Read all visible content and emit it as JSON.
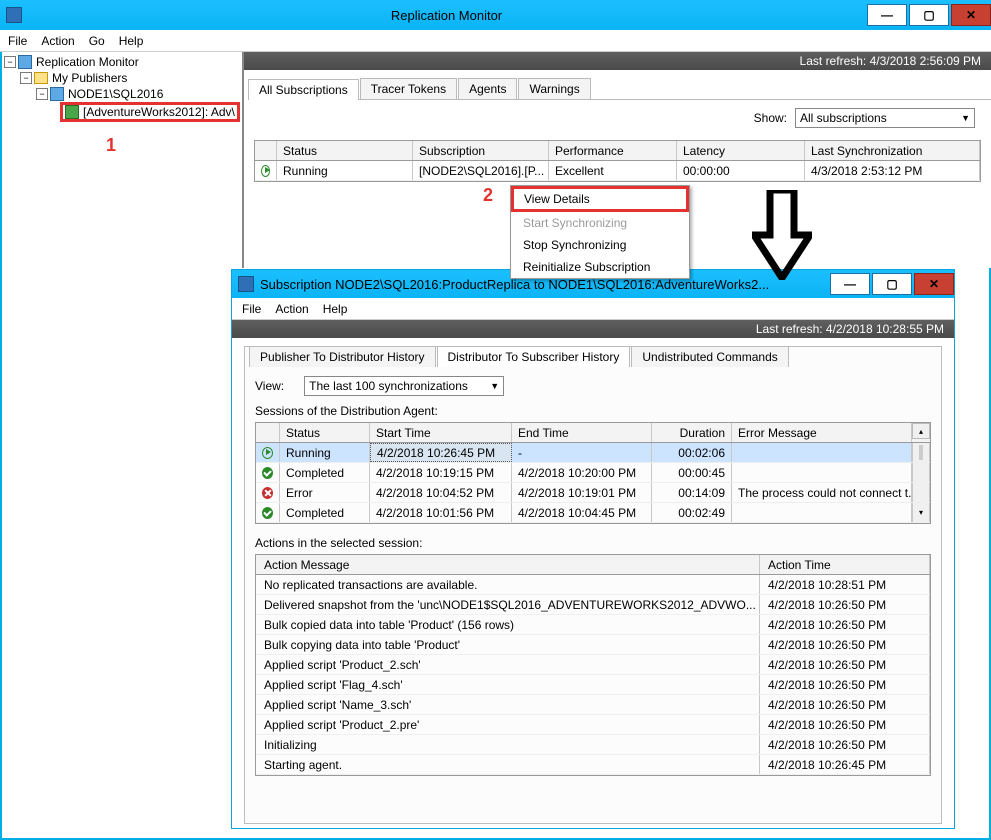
{
  "win1": {
    "title": "Replication Monitor",
    "menu": [
      "File",
      "Action",
      "Go",
      "Help"
    ],
    "last_refresh": "Last refresh: 4/3/2018 2:56:09 PM",
    "tree": {
      "root": "Replication Monitor",
      "publishers": "My Publishers",
      "node": "NODE1\\SQL2016",
      "pub": "[AdventureWorks2012]: Adv\\"
    },
    "tabs": [
      "All Subscriptions",
      "Tracer Tokens",
      "Agents",
      "Warnings"
    ],
    "show_label": "Show:",
    "show_value": "All subscriptions",
    "grid_headers": {
      "status": "Status",
      "subscription": "Subscription",
      "performance": "Performance",
      "latency": "Latency",
      "last_sync": "Last Synchronization"
    },
    "row": {
      "status": "Running",
      "subscription": "[NODE2\\SQL2016].[P...",
      "performance": "Excellent",
      "latency": "00:00:00",
      "last_sync": "4/3/2018 2:53:12 PM"
    },
    "ctx": {
      "view_details": "View Details",
      "start": "Start Synchronizing",
      "stop": "Stop Synchronizing",
      "reinit": "Reinitialize Subscription"
    },
    "callout1": "1",
    "callout2": "2"
  },
  "win2": {
    "title": "Subscription NODE2\\SQL2016:ProductReplica to NODE1\\SQL2016:AdventureWorks2...",
    "menu": [
      "File",
      "Action",
      "Help"
    ],
    "last_refresh": "Last refresh: 4/2/2018 10:28:55 PM",
    "tabs": [
      "Publisher To Distributor History",
      "Distributor To Subscriber History",
      "Undistributed Commands"
    ],
    "view_label": "View:",
    "view_value": "The last 100 synchronizations",
    "sessions_label": "Sessions of the Distribution Agent:",
    "sess_headers": {
      "status": "Status",
      "start": "Start Time",
      "end": "End Time",
      "duration": "Duration",
      "error": "Error Message"
    },
    "sessions": [
      {
        "icon": "run",
        "status": "Running",
        "start": "4/2/2018 10:26:45 PM",
        "end": "-",
        "duration": "00:02:06",
        "error": ""
      },
      {
        "icon": "ok",
        "status": "Completed",
        "start": "4/2/2018 10:19:15 PM",
        "end": "4/2/2018 10:20:00 PM",
        "duration": "00:00:45",
        "error": ""
      },
      {
        "icon": "err",
        "status": "Error",
        "start": "4/2/2018 10:04:52 PM",
        "end": "4/2/2018 10:19:01 PM",
        "duration": "00:14:09",
        "error": "The process could not connect t..."
      },
      {
        "icon": "ok",
        "status": "Completed",
        "start": "4/2/2018 10:01:56 PM",
        "end": "4/2/2018 10:04:45 PM",
        "duration": "00:02:49",
        "error": ""
      }
    ],
    "actions_label": "Actions in the selected session:",
    "act_headers": {
      "msg": "Action Message",
      "time": "Action Time"
    },
    "actions": [
      {
        "msg": "No replicated transactions are available.",
        "time": "4/2/2018 10:28:51 PM"
      },
      {
        "msg": "Delivered snapshot from the 'unc\\NODE1$SQL2016_ADVENTUREWORKS2012_ADVWO...",
        "time": "4/2/2018 10:26:50 PM"
      },
      {
        "msg": "Bulk copied data into table 'Product' (156 rows)",
        "time": "4/2/2018 10:26:50 PM"
      },
      {
        "msg": "Bulk copying data into table 'Product'",
        "time": "4/2/2018 10:26:50 PM"
      },
      {
        "msg": "Applied script 'Product_2.sch'",
        "time": "4/2/2018 10:26:50 PM"
      },
      {
        "msg": "Applied script 'Flag_4.sch'",
        "time": "4/2/2018 10:26:50 PM"
      },
      {
        "msg": "Applied script 'Name_3.sch'",
        "time": "4/2/2018 10:26:50 PM"
      },
      {
        "msg": "Applied script 'Product_2.pre'",
        "time": "4/2/2018 10:26:50 PM"
      },
      {
        "msg": "Initializing",
        "time": "4/2/2018 10:26:50 PM"
      },
      {
        "msg": "Starting agent.",
        "time": "4/2/2018 10:26:45 PM"
      }
    ]
  }
}
